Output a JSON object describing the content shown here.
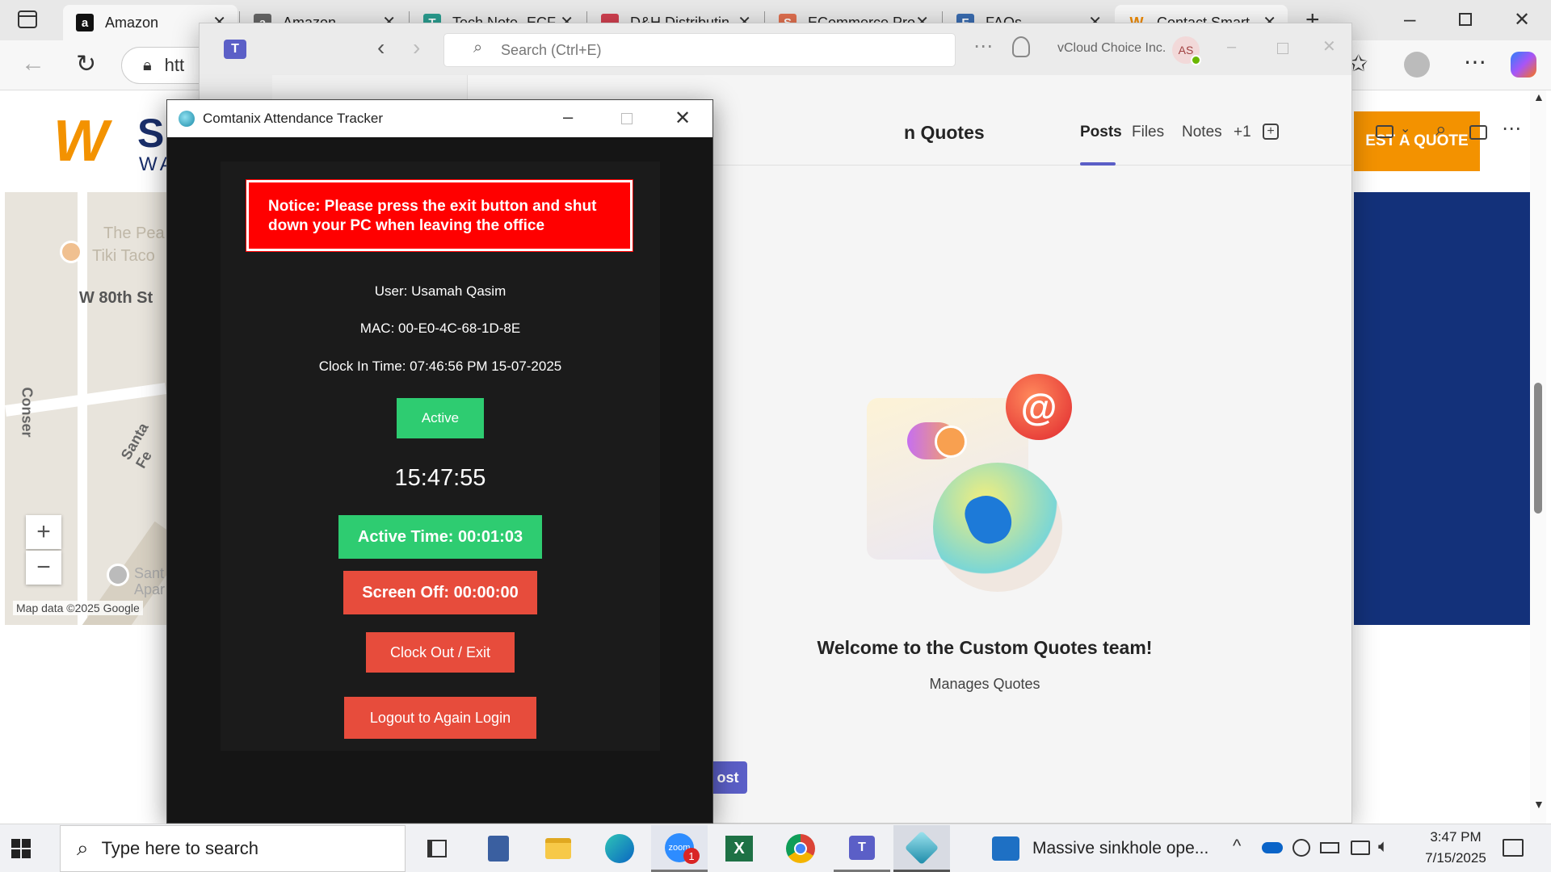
{
  "browser": {
    "tabs": [
      {
        "title": "Amazon",
        "icon": "amazon-icon",
        "color": "#111111",
        "letter": "a"
      },
      {
        "title": "Amazon",
        "icon": "amazon-icon",
        "color": "#555555",
        "letter": "a"
      },
      {
        "title": "Tech Note- ECF",
        "icon": "tech-note-icon",
        "color": "#2a9d8f",
        "letter": "T"
      },
      {
        "title": "D&H Distributin",
        "icon": "dh-icon",
        "color": "#d04050",
        "letter": ""
      },
      {
        "title": "ECommerce Pro",
        "icon": "ecommerce-icon",
        "color": "#e07050",
        "letter": "S"
      },
      {
        "title": "FAQs",
        "icon": "faqs-icon",
        "color": "#3a6cb0",
        "letter": "F"
      },
      {
        "title": "Contact Smart",
        "icon": "smart-icon",
        "color": "#f08a00",
        "letter": "W"
      }
    ],
    "address_text": "htt",
    "website": {
      "logo_letters": "S",
      "logo_sub": "WA",
      "quote_button": "EST A QUOTE",
      "map_labels": [
        "The Pea",
        "Tiki Taco",
        "W 80th St",
        "Conser",
        "Santa Fe",
        "Sant",
        "Apar"
      ],
      "map_attribution": "Map data ©2025 Google",
      "zoom_in": "+",
      "zoom_out": "−"
    }
  },
  "teams": {
    "search_placeholder": "Search (Ctrl+E)",
    "org_name": "vCloud Choice Inc.",
    "avatar_initials": "AS",
    "team_title": "n Quotes",
    "tabs": [
      "Posts",
      "Files",
      "Notes",
      "+1"
    ],
    "active_tab": "Posts",
    "welcome_title": "Welcome to the Custom Quotes team!",
    "welcome_sub": "Manages Quotes",
    "post_button": "ost",
    "accent_color": "#5b5fc7"
  },
  "tracker": {
    "window_title": "Comtanix Attendance Tracker",
    "notice": "Notice: Please press the exit button and shut down your PC when leaving the office",
    "user": "User: Usamah Qasim",
    "mac": "MAC: 00-E0-4C-68-1D-8E",
    "clock_in": "Clock In Time: 07:46:56 PM 15-07-2025",
    "status": "Active",
    "clock": "15:47:55",
    "active_time": "Active Time: 00:01:03",
    "screen_off": "Screen Off: 00:00:00",
    "clock_out": "Clock Out / Exit",
    "logout": "Logout to Again Login",
    "colors": {
      "green": "#2ecc71",
      "red": "#e74c3c",
      "notice_red": "#ff0000"
    }
  },
  "taskbar": {
    "search_placeholder": "Type here to search",
    "news_text": "Massive sinkhole ope...",
    "time": "3:47 PM",
    "date": "7/15/2025",
    "zoom_badge": "1"
  }
}
